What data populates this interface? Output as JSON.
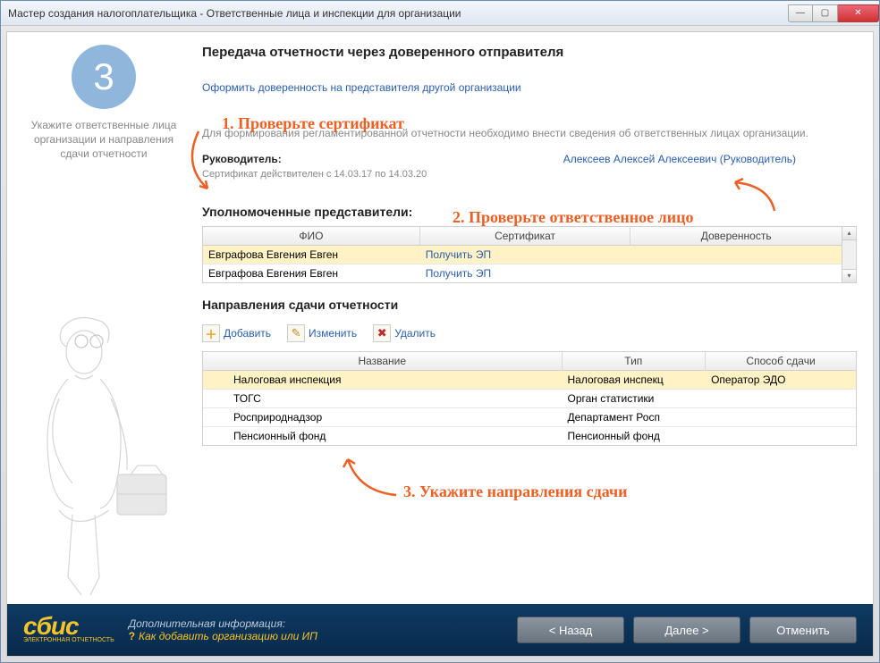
{
  "window": {
    "title": "Мастер создания налогоплательщика - Ответственные лица и инспекции для организации"
  },
  "sidebar": {
    "step": "3",
    "hint": "Укажите ответственные лица организации и направления сдачи отчетности"
  },
  "main": {
    "heading": "Передача отчетности через доверенного отправителя",
    "proxy_link": "Оформить доверенность на представителя другой организации",
    "info_text": "Для формирования регламентированной отчетности необходимо внести сведения об ответственных лицах организации.",
    "leader_label": "Руководитель:",
    "cert_text": "Сертификат действителен с 14.03.17 по 14.03.20",
    "leader_link": "Алексеев Алексей Алексеевич (Руководитель)",
    "reps_heading": "Уполномоченные представители:",
    "directions_heading": "Направления сдачи отчетности"
  },
  "reps": {
    "cols": {
      "c1": "ФИО",
      "c2": "Сертификат",
      "c3": "Доверенность"
    },
    "rows": [
      {
        "fio": "Евграфова Евгения Евген",
        "cert": "Получить ЭП",
        "dov": ""
      },
      {
        "fio": "Евграфова Евгения Евген",
        "cert": "Получить ЭП",
        "dov": ""
      }
    ]
  },
  "toolbar": {
    "add": "Добавить",
    "edit": "Изменить",
    "delete": "Удалить"
  },
  "dirs": {
    "cols": {
      "c1": "Название",
      "c2": "Тип",
      "c3": "Способ сдачи"
    },
    "rows": [
      {
        "name": "Налоговая инспекция",
        "type": "Налоговая инспекц",
        "method": "Оператор ЭДО",
        "hl": true
      },
      {
        "name": "ТОГС",
        "type": "Орган статистики",
        "method": ""
      },
      {
        "name": "Росприроднадзор",
        "type": "Департамент Росп",
        "method": ""
      },
      {
        "name": "Пенсионный фонд",
        "type": "Пенсионный фонд",
        "method": ""
      }
    ]
  },
  "annotations": {
    "a1": "1. Проверьте сертификат",
    "a2": "2. Проверьте ответственное лицо",
    "a3": "3. Укажите направления сдачи"
  },
  "footer": {
    "logo": "сбис",
    "logo_sub": "ЭЛЕКТРОННАЯ ОТЧЕТНОСТЬ",
    "info_title": "Дополнительная информация:",
    "info_link": "Как добавить организацию или ИП",
    "back": "< Назад",
    "next": "Далее >",
    "cancel": "Отменить"
  }
}
